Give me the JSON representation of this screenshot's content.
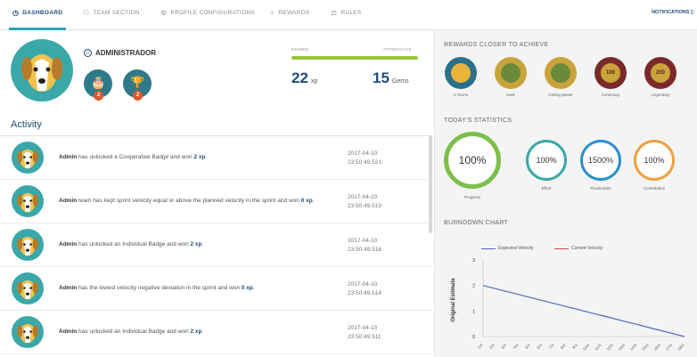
{
  "nav": {
    "tabs": [
      {
        "label": "DASHBOARD",
        "icon": "clock-icon"
      },
      {
        "label": "TEAM SECTION",
        "icon": "team-icon"
      },
      {
        "label": "PROFILE CONFIGURATIONS",
        "icon": "gear-icon"
      },
      {
        "label": "REWARDS",
        "icon": "trophy-icon"
      },
      {
        "label": "RULES",
        "icon": "rules-icon"
      }
    ],
    "notifications": "NOTIFICATIONS"
  },
  "profile": {
    "name": "ADMINISTRADOR",
    "badges": [
      {
        "count": "2",
        "color": "#2f7a8a"
      },
      {
        "count": "2",
        "color": "#2f7a8a"
      }
    ],
    "level_from": "NEWBIE",
    "level_to": "APPRENTICE",
    "level_progress": 1.0,
    "xp_value": "22",
    "xp_unit": "xp",
    "gems_value": "15",
    "gems_unit": "Gems"
  },
  "activity": {
    "title": "Activity",
    "items": [
      {
        "user": "Admin",
        "text": "has unlocked a Cooperative Badge and won",
        "amount": "2 xp",
        "end": ".",
        "date": "2017-04-10",
        "time": "23:50:49.521"
      },
      {
        "user": "Admin",
        "text": "team has kept sprint velocity equal or above the planned velocity in the sprint and won",
        "amount": "0 xp",
        "end": ".",
        "date": "2017-04-10",
        "time": "23:50:49.519"
      },
      {
        "user": "Admin",
        "text": "has unlocked an Individual Badge and won",
        "amount": "2 xp",
        "end": ".",
        "date": "2017-04-10",
        "time": "23:50:49.516"
      },
      {
        "user": "Admin",
        "text": "has the lowest velocity negative deviation in the sprint and won",
        "amount": "0 xp",
        "end": ".",
        "date": "2017-04-10",
        "time": "23:50:49.514"
      },
      {
        "user": "Admin",
        "text": "has unlocked an Individual Badge and won",
        "amount": "2 xp",
        "end": ".",
        "date": "2017-04-10",
        "time": "23:50:49.511"
      }
    ]
  },
  "rewards": {
    "title": "REWARDS CLOSER TO ACHIEVE",
    "items": [
      {
        "label": "5 Gems",
        "color": "#2b6f8a",
        "inner": "#e8b43a"
      },
      {
        "label": "Dark",
        "color": "#c9a43a",
        "inner": "#6a8a3a"
      },
      {
        "label": "Getting Better",
        "color": "#c9a43a",
        "inner": "#6a8a3a"
      },
      {
        "label": "Centenary",
        "color": "#7a2a2a",
        "inner": "#c9a43a",
        "mark": "100"
      },
      {
        "label": "Legendary",
        "color": "#7a2a2a",
        "inner": "#c9a43a",
        "mark": "200"
      }
    ]
  },
  "stats": {
    "title": "TODAY'S STATISTICS",
    "items": [
      {
        "value": "100%",
        "label": "Progress",
        "color": "#7cbf4b"
      },
      {
        "value": "100%",
        "label": "Effort",
        "color": "#3aa8a8"
      },
      {
        "value": "1500%",
        "label": "Productivity",
        "color": "#2a8fd0"
      },
      {
        "value": "100%",
        "label": "Contribution",
        "color": "#f0a040"
      }
    ]
  },
  "burndown": {
    "title": "BURNDOWN CHART",
    "legend_expected": "Expected Velocity",
    "legend_current": "Current Velocity",
    "expected_color": "#4a6fc4",
    "current_color": "#d04a3a"
  },
  "chart_data": {
    "type": "line",
    "ylabel": "Original Estimate",
    "xlabel": "",
    "ylim": [
      0,
      3
    ],
    "yticks": [
      "0",
      "1",
      "2",
      "3"
    ],
    "categories": [
      "1/4",
      "2/4",
      "3/4",
      "4/4",
      "5/4",
      "6/4",
      "7/4",
      "8/4",
      "9/4",
      "10/4",
      "11/4",
      "12/4",
      "13/4",
      "14/4",
      "15/4",
      "16/4",
      "17/4",
      "18/4"
    ],
    "series": [
      {
        "name": "Expected Velocity",
        "values": [
          2,
          1.882,
          1.765,
          1.647,
          1.529,
          1.412,
          1.294,
          1.176,
          1.059,
          0.941,
          0.824,
          0.706,
          0.588,
          0.471,
          0.353,
          0.235,
          0.118,
          0
        ]
      },
      {
        "name": "Current Velocity",
        "values": []
      }
    ]
  }
}
